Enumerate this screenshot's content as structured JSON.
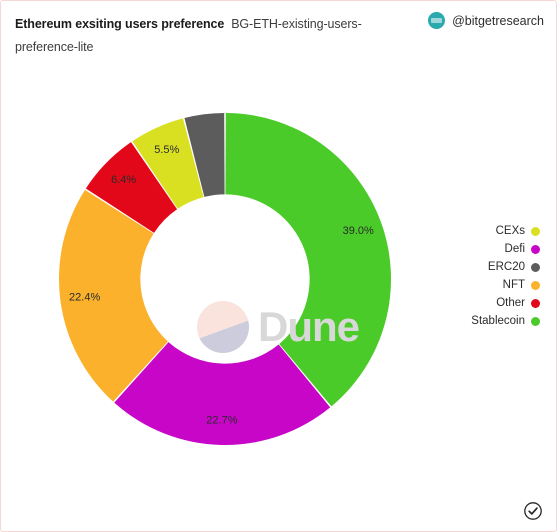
{
  "header": {
    "title": "Ethereum exsiting users preference",
    "subtitle": "BG-ETH-existing-users-preference-lite",
    "account_handle": "@bitgetresearch",
    "avatar_icon": "bitget-avatar-icon"
  },
  "watermark": {
    "text": "Dune",
    "logo_icon": "dune-logo-icon"
  },
  "footer": {
    "verified_icon": "circle-check-icon"
  },
  "legend": {
    "items": [
      {
        "label": "CEXs",
        "color": "#d9e021"
      },
      {
        "label": "Defi",
        "color": "#c806c8"
      },
      {
        "label": "ERC20",
        "color": "#5c5c5c"
      },
      {
        "label": "NFT",
        "color": "#fbb12b"
      },
      {
        "label": "Other",
        "color": "#e2081a"
      },
      {
        "label": "Stablecoin",
        "color": "#4acb29"
      }
    ]
  },
  "chart_data": {
    "type": "pie",
    "title": "Ethereum exsiting users preference",
    "subtitle": "BG-ETH-existing-users-preference-lite",
    "donut": true,
    "inner_radius_ratio": 0.51,
    "start_angle_deg": 0,
    "direction": "clockwise",
    "legend_position": "right",
    "value_unit": "%",
    "categories": [
      "Stablecoin",
      "Defi",
      "NFT",
      "Other",
      "CEXs",
      "ERC20"
    ],
    "values": [
      39.0,
      22.7,
      22.4,
      6.4,
      5.5,
      4.0
    ],
    "labels": [
      "39.0%",
      "22.7%",
      "22.4%",
      "6.4%",
      "5.5%",
      ""
    ],
    "colors": [
      "#4acb29",
      "#c806c8",
      "#fbb12b",
      "#e2081a",
      "#d9e021",
      "#5c5c5c"
    ],
    "slices": [
      {
        "name": "Stablecoin",
        "value": 39.0,
        "label": "39.0%",
        "color": "#4acb29"
      },
      {
        "name": "Defi",
        "value": 22.7,
        "label": "22.7%",
        "color": "#c806c8"
      },
      {
        "name": "NFT",
        "value": 22.4,
        "label": "22.4%",
        "color": "#fbb12b"
      },
      {
        "name": "Other",
        "value": 6.4,
        "label": "6.4%",
        "color": "#e2081a"
      },
      {
        "name": "CEXs",
        "value": 5.5,
        "label": "5.5%",
        "color": "#d9e021"
      },
      {
        "name": "ERC20",
        "value": 4.0,
        "label": "",
        "color": "#5c5c5c"
      }
    ]
  }
}
